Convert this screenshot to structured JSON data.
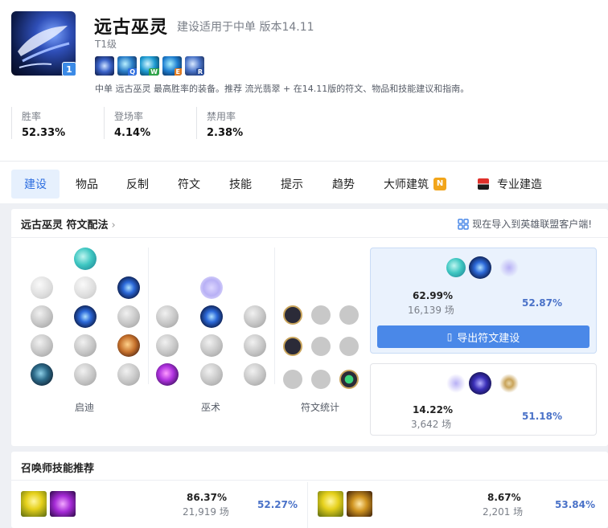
{
  "header": {
    "champion_name": "远古巫灵",
    "build_version": "建设适用于中单 版本14.11",
    "tier": "T1级",
    "level_badge": "1",
    "skills": [
      {
        "icon": "passive-icon",
        "key": ""
      },
      {
        "icon": "skill-q-icon",
        "key": "Q"
      },
      {
        "icon": "skill-w-icon",
        "key": "W"
      },
      {
        "icon": "skill-e-icon",
        "key": "E"
      },
      {
        "icon": "skill-r-icon",
        "key": "R"
      }
    ],
    "description": "中单 远古巫灵 最高胜率的装备。推荐 流光翡翠 + 在14.11版的符文、物品和技能建议和指南。",
    "stats": [
      {
        "label": "胜率",
        "value": "52.33%"
      },
      {
        "label": "登场率",
        "value": "4.14%"
      },
      {
        "label": "禁用率",
        "value": "2.38%"
      }
    ]
  },
  "tabs": [
    {
      "label": "建设",
      "active": true
    },
    {
      "label": "物品"
    },
    {
      "label": "反制"
    },
    {
      "label": "符文"
    },
    {
      "label": "技能"
    },
    {
      "label": "提示"
    },
    {
      "label": "趋势"
    },
    {
      "label": "大师建筑",
      "badge": "N"
    },
    {
      "label": "专业建造",
      "icon": "pro-build-icon"
    }
  ],
  "rune_panel": {
    "title": "远古巫灵 符文配法",
    "import_text": "现在导入到英雄联盟客户端!",
    "columns": [
      "启迪",
      "巫术",
      "符文统计"
    ],
    "page1": {
      "pick_rate": "62.99%",
      "games": "16,139 场",
      "win_rate": "52.87%",
      "export_label": "导出符文建设"
    },
    "page2": {
      "pick_rate": "14.22%",
      "games": "3,642 场",
      "win_rate": "51.18%"
    }
  },
  "summoner_panel": {
    "title": "召唤师技能推荐",
    "rows": [
      {
        "pick_rate": "86.37%",
        "games": "21,919 场",
        "win_rate": "52.27%",
        "spells": [
          "flash-icon",
          "purple-spell-icon"
        ]
      },
      {
        "pick_rate": "8.67%",
        "games": "2,201 场",
        "win_rate": "53.84%",
        "spells": [
          "flash-icon",
          "ignite-icon"
        ]
      }
    ]
  },
  "colors": {
    "accent": "#2f6fe0",
    "win_rate": "#4a72c8",
    "badge": "#f2a51a",
    "button": "#4a88e8"
  }
}
